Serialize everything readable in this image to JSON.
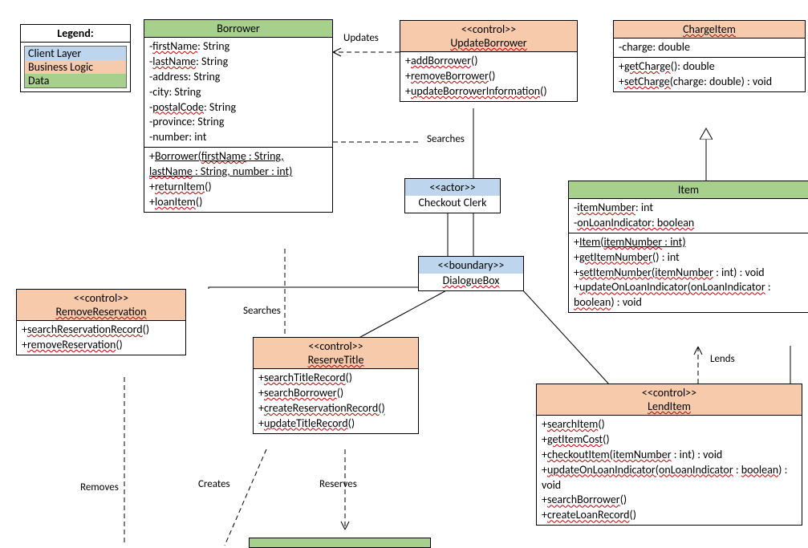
{
  "legend": {
    "title": "Legend:",
    "client": "Client Layer",
    "business": "Business Logic",
    "data": "Data"
  },
  "borrower": {
    "title": "Borrower",
    "attrs": [
      "-firstName: String",
      "-lastName: String",
      "-address: String",
      "-city: String",
      "-postalCode: String",
      "-province: String",
      "-number: int"
    ],
    "ops": [
      "+Borrower(firstName : String, lastName : String, number : int)",
      "+returnItem()",
      "+loanItem()"
    ]
  },
  "updateBorrower": {
    "stereo": "<<control>>",
    "name": "UpdateBorrower",
    "ops": [
      "+addBorrower()",
      "+removeBorrower()",
      "+updateBorrowerInformation()"
    ]
  },
  "chargeItem": {
    "name": "ChargeItem",
    "attrs": [
      "-charge: double"
    ],
    "ops": [
      "+getCharge(): double",
      "+setCharge(charge: double) : void"
    ]
  },
  "actor": {
    "stereo": "<<actor>>",
    "name": "Checkout Clerk"
  },
  "dialogue": {
    "stereo": "<<boundary>>",
    "name": "DialogueBox"
  },
  "item": {
    "title": "Item",
    "attrs": [
      "-itemNumber: int",
      "-onLoanIndicator: boolean"
    ],
    "ops": [
      "+Item(itemNumber : int)",
      "+getItemNumber() : int",
      "+setItemNumber(itemNumber : int) : void",
      "+updateOnLoanIndicator(onLoanIndicator : boolean) : void"
    ]
  },
  "removeReservation": {
    "stereo": "<<control>>",
    "name": "RemoveReservation",
    "ops": [
      "+searchReservationRecord()",
      "+removeReservation()"
    ]
  },
  "reserveTitle": {
    "stereo": "<<control>>",
    "name": "ReserveTitle",
    "ops": [
      "+searchTitleRecord()",
      "+searchBorrower()",
      "+createReservationRecord()",
      "+updateTitleRecord()"
    ]
  },
  "lendItem": {
    "stereo": "<<control>>",
    "name": "LendItem",
    "ops": [
      "+searchItem()",
      "+getItemCost()",
      "+checkoutItem(itemNumber : int) : void",
      "+updateOnLoanIndicator(onLoanIndicator : boolean) : void",
      "+searchBorrower()",
      "+createLoanRecord()"
    ]
  },
  "labels": {
    "updates": "Updates",
    "searches1": "Searches",
    "searches2": "Searches",
    "lends": "Lends",
    "removes": "Removes",
    "creates": "Creates",
    "reserves": "Reserves"
  }
}
